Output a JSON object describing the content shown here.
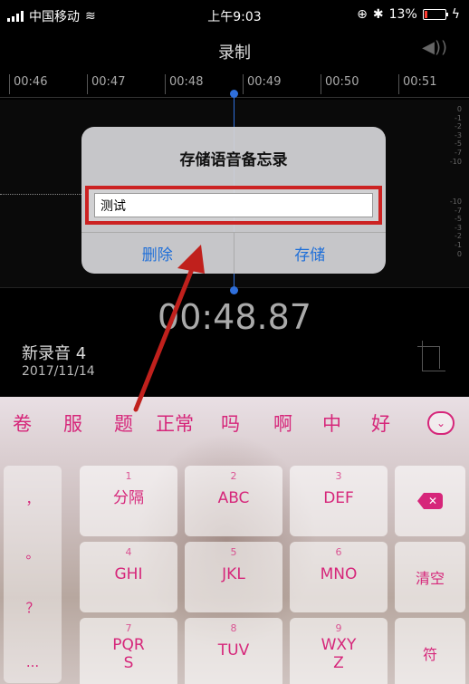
{
  "status_bar": {
    "carrier": "中国移动",
    "time": "上午9:03",
    "battery": "13%",
    "battery_level": 0.13
  },
  "header": {
    "title": "录制"
  },
  "timeline": {
    "ticks": [
      "00:46",
      "00:47",
      "00:48",
      "00:49",
      "00:50",
      "00:51"
    ],
    "db_upper": [
      "0",
      "-1",
      "-2",
      "-3",
      "-5",
      "-7",
      "-10"
    ],
    "db_lower": [
      "-10",
      "-7",
      "-5",
      "-3",
      "-2",
      "-1",
      "0"
    ]
  },
  "recording": {
    "elapsed": "00:48.87",
    "name": "新录音 4",
    "date": "2017/11/14"
  },
  "dialog": {
    "title": "存储语音备忘录",
    "input_value": "测试",
    "delete_label": "删除",
    "save_label": "存储"
  },
  "keyboard": {
    "candidates": [
      "卷",
      "服",
      "题",
      "正常",
      "吗",
      "啊",
      "中",
      "好"
    ],
    "punctuation": [
      "，",
      "。",
      "？",
      "..."
    ],
    "keys": [
      {
        "num": "1",
        "label": "分隔"
      },
      {
        "num": "2",
        "label": "ABC"
      },
      {
        "num": "3",
        "label": "DEF"
      },
      {
        "num": "4",
        "label": "GHI"
      },
      {
        "num": "5",
        "label": "JKL"
      },
      {
        "num": "6",
        "label": "MNO"
      },
      {
        "num": "7",
        "label": "PQR\nS"
      },
      {
        "num": "8",
        "label": "TUV"
      },
      {
        "num": "9",
        "label": "WXY\nZ"
      }
    ],
    "clear_label": "清空",
    "symbol_label": "符",
    "accent": "#d6267a"
  }
}
